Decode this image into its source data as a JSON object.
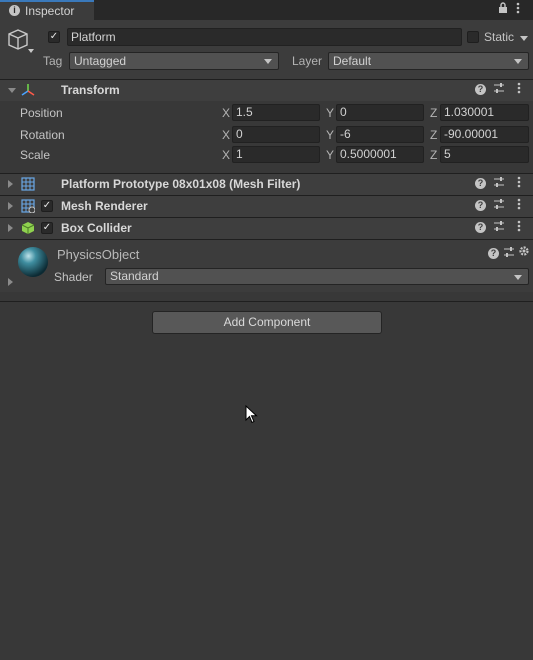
{
  "tab": {
    "label": "Inspector",
    "info_icon": "i"
  },
  "tabbar_icons": {
    "lock": "lock-icon",
    "menu": "kebab-menu-icon"
  },
  "object": {
    "active": true,
    "name": "Platform",
    "static_label": "Static",
    "tag_label": "Tag",
    "tag_value": "Untagged",
    "layer_label": "Layer",
    "layer_value": "Default"
  },
  "transform": {
    "title": "Transform",
    "position": {
      "label": "Position",
      "x": "1.5",
      "y": "0",
      "z": "1.030001"
    },
    "rotation": {
      "label": "Rotation",
      "x": "0",
      "y": "-6",
      "z": "-90.00001"
    },
    "scale": {
      "label": "Scale",
      "x": "1",
      "y": "0.5000001",
      "z": "5"
    },
    "axes": {
      "x": "X",
      "y": "Y",
      "z": "Z"
    }
  },
  "components": [
    {
      "title": "Platform Prototype 08x01x08 (Mesh Filter)",
      "checkbox": false
    },
    {
      "title": "Mesh Renderer",
      "checkbox": true
    },
    {
      "title": "Box Collider",
      "checkbox": true
    }
  ],
  "material": {
    "name": "PhysicsObject",
    "shader_label": "Shader",
    "shader_value": "Standard"
  },
  "add_component_label": "Add Component",
  "colors": {
    "tab_accent": "#3a79bb",
    "box_collider_icon": "#8fd14f",
    "background": "#383838"
  }
}
